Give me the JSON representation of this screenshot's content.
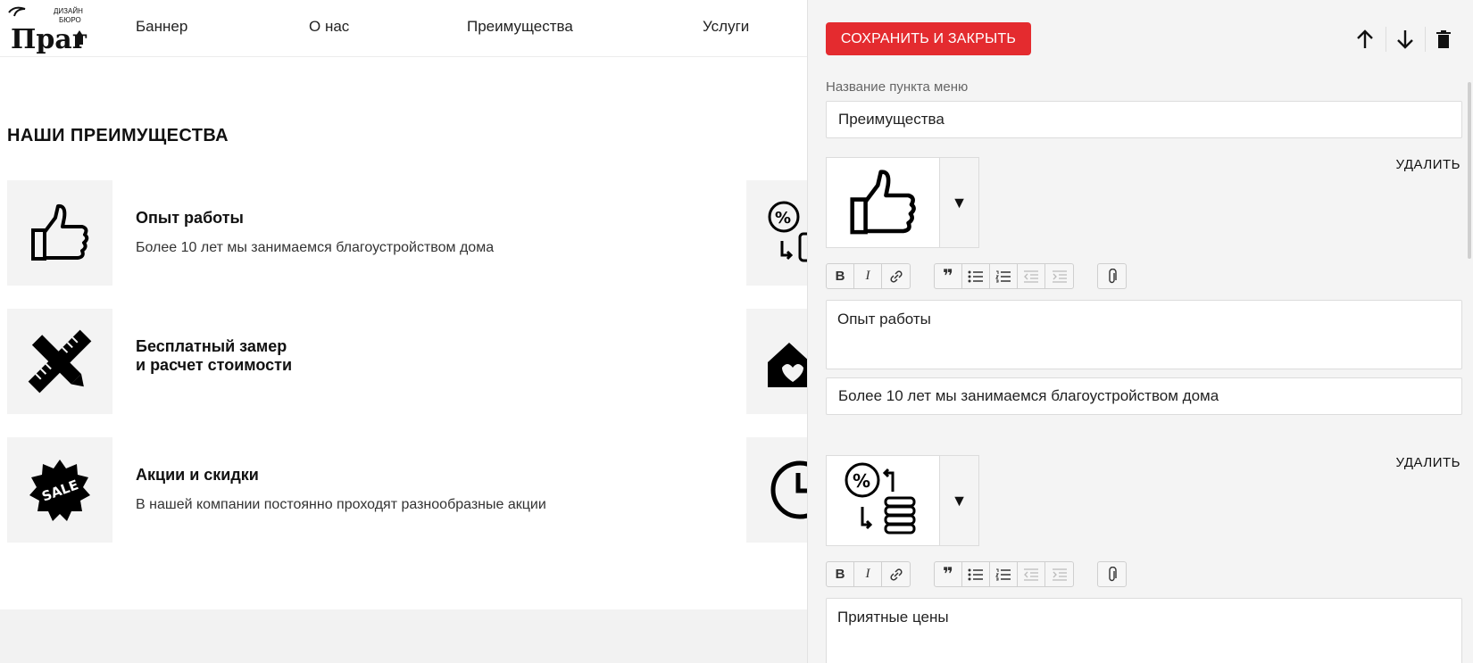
{
  "site": {
    "logo": {
      "line1": "ДИЗАЙН",
      "line2": "БЮРО",
      "name": "Прага"
    },
    "nav": [
      "Баннер",
      "О нас",
      "Преимущества",
      "Услуги"
    ],
    "section_title": "НАШИ ПРЕИМУЩЕСТВА",
    "advantages": [
      {
        "icon": "thumbs-up-icon",
        "title": "Опыт работы",
        "desc": "Более 10 лет мы занимаемся благоустройством дома"
      },
      {
        "icon": "ruler-pencil-icon",
        "title_line1": "Бесплатный замер",
        "title_line2": "и расчет стоимости",
        "desc": ""
      },
      {
        "icon": "sale-badge-icon",
        "title": "Акции и скидки",
        "desc": "В нашей компании постоянно проходят разнообразные акции"
      }
    ]
  },
  "panel": {
    "save_label": "СОХРАНИТЬ И ЗАКРЫТЬ",
    "menu_name_label": "Название пункта меню",
    "menu_name_value": "Преимущества",
    "delete_label": "УДАЛИТЬ",
    "items": [
      {
        "icon": "thumbs-up-icon",
        "title": "Опыт работы",
        "desc": "Более 10 лет мы занимаемся благоустройством дома"
      },
      {
        "icon": "percent-coins-icon",
        "title": "Приятные цены"
      }
    ],
    "rte": {
      "bold": "B",
      "italic": "I"
    }
  }
}
